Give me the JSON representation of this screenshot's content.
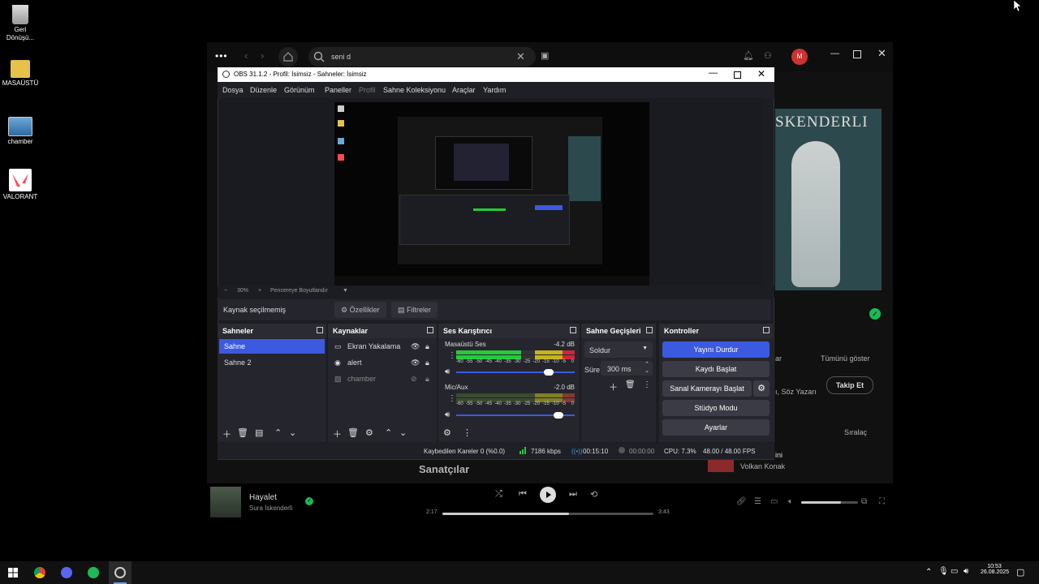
{
  "desktop": {
    "icons": [
      {
        "label": "Geri\nDönüşü...",
        "name": "recycle-bin"
      },
      {
        "label": "MASAÜSTÜ",
        "name": "folder"
      },
      {
        "label": "chamber",
        "name": "image-file"
      },
      {
        "label": "VALORANT",
        "name": "valorant"
      }
    ]
  },
  "spotify": {
    "search_text": "seni d",
    "artist_banner": "SKENDERLI",
    "show_all": "Tümünü göster",
    "follow": "Takip Et",
    "partial_label_ar": "ar",
    "partial_lyric": "ı, Söz Yazarı",
    "sort": "Sıralaç",
    "artists_heading": "Sanatçılar",
    "related_partial": "ini",
    "related_artist": "Volkan Konak",
    "now_playing_title": "Hayalet",
    "now_playing_artist": "Sura İskenderli",
    "time_elapsed": "2:17",
    "time_total": "3:43",
    "progress": 0.6,
    "volume": 0.7
  },
  "obs": {
    "title": "OBS 31.1.2 - Profil: İsimsiz - Sahneler: İsimsiz",
    "menu": [
      "Dosya",
      "Düzenle",
      "Görünüm",
      "Paneller",
      "Profil",
      "Sahne Koleksiyonu",
      "Araçlar",
      "Yardım"
    ],
    "zoom": {
      "minus": "−",
      "value": "30%",
      "plus": "+",
      "fit": "Pencereye Boyutlandır"
    },
    "source_bar": {
      "label": "Kaynak seçilmemiş",
      "properties": "Özellikler",
      "filters": "Filtreler"
    },
    "scenes": {
      "title": "Sahneler",
      "items": [
        "Sahne",
        "Sahne 2"
      ],
      "selected": 0
    },
    "sources": {
      "title": "Kaynaklar",
      "items": [
        "Ekran Yakalama",
        "alert",
        "chamber"
      ]
    },
    "mixer": {
      "title": "Ses Karıştırıcı",
      "channels": [
        {
          "name": "Masaüstü Ses",
          "db": "-4.2 dB",
          "level": 0.55,
          "volume": 0.78
        },
        {
          "name": "Mic/Aux",
          "db": "-2.0 dB",
          "level": 0.0,
          "volume": 0.86
        }
      ],
      "scale": [
        "-60",
        "-55",
        "-50",
        "-45",
        "-40",
        "-35",
        "-30",
        "-25",
        "-20",
        "-15",
        "-10",
        "-5",
        "0"
      ]
    },
    "transitions": {
      "title": "Sahne Geçişleri",
      "type": "Soldur",
      "duration_label": "Süre",
      "duration": "300 ms"
    },
    "controls": {
      "title": "Kontroller",
      "buttons": [
        "Yayını Durdur",
        "Kaydı Başlat",
        "Sanal Kamerayı Başlat",
        "Stüdyo Modu",
        "Ayarlar"
      ]
    },
    "status": {
      "dropped": "Kaybedilen Kareler 0 (%0.0)",
      "bitrate": "7186 kbps",
      "stream_time": "00:15:10",
      "rec_time": "00:00:00",
      "cpu": "CPU: 7.3%",
      "fps": "48.00 / 48.00 FPS"
    }
  },
  "taskbar": {
    "time": "10:53",
    "date": "26.08.2025"
  }
}
